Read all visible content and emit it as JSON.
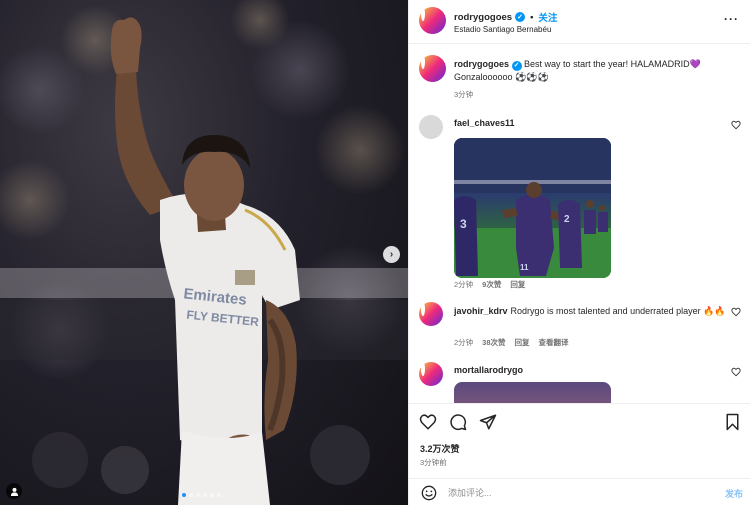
{
  "post": {
    "header": {
      "username": "rodrygogoes",
      "separator": "•",
      "follow_label": "关注",
      "location": "Estadio Santiago Bernabéu",
      "more_label": "···"
    },
    "caption": {
      "username": "rodrygogoes",
      "text": "Best way to start the year! HALAMADRID💜 Gonzaloooooo ⚽⚽⚽",
      "time": "3分钟"
    },
    "comments": [
      {
        "username": "fael_chaves11",
        "text": "",
        "time": "2分钟",
        "likes": "9次赞",
        "reply_label": "回复"
      },
      {
        "username": "javohir_kdrv",
        "text": "Rodrygo is most talented and underrated player 🔥🔥",
        "time": "2分钟",
        "likes": "38次赞",
        "reply_label": "回复",
        "translate_label": "查看翻译"
      },
      {
        "username": "mortallarodrygo",
        "text": ""
      }
    ],
    "likes_count": "3.2万次赞",
    "post_time": "3分钟前",
    "comment_input": {
      "placeholder": "添加评论...",
      "value": ""
    },
    "post_button_label": "发布"
  },
  "colors": {
    "accent": "#0095f6",
    "text": "#262626",
    "muted": "#737373",
    "border": "#efefef"
  },
  "icons": [
    "heart-icon",
    "comment-icon",
    "share-icon",
    "bookmark-icon",
    "emoji-icon",
    "verified-icon",
    "chevron-right-icon",
    "tagged-user-icon"
  ]
}
